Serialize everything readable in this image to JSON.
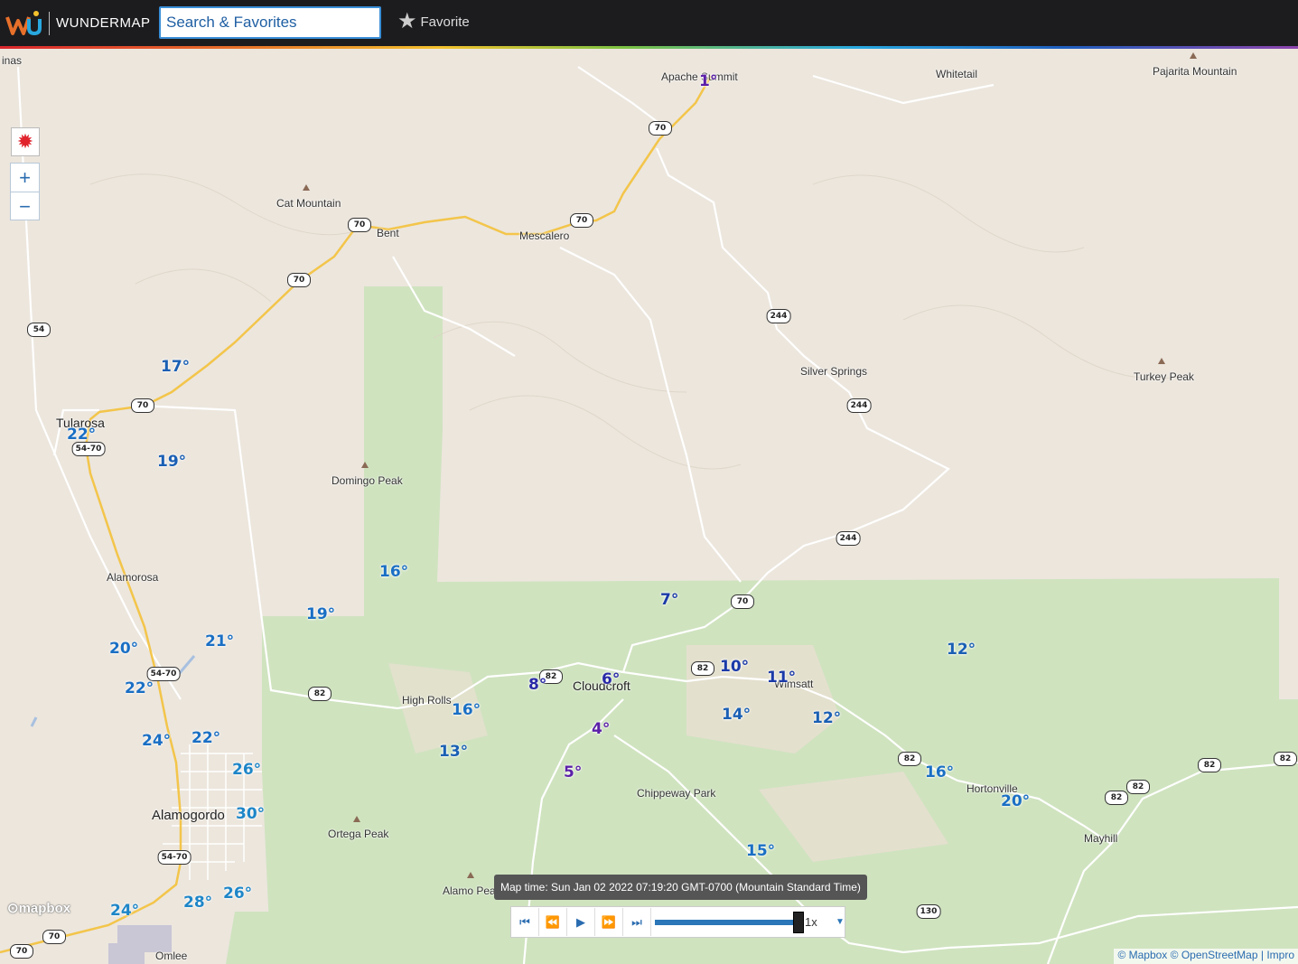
{
  "header": {
    "brand": "WUNDERMAP",
    "search_placeholder": "Search & Favorites",
    "favorite_label": "Favorite"
  },
  "controls": {
    "zoom_in": "+",
    "zoom_out": "−"
  },
  "player": {
    "map_time": "Map time: Sun Jan 02 2022 07:19:20 GMT-0700 (Mountain Standard Time)",
    "speed": "1x",
    "progress": 1.0
  },
  "attribution": {
    "logo": "mapbox",
    "text": "© Mapbox © OpenStreetMap | Impro"
  },
  "places": [
    {
      "name": "inas"
    },
    {
      "name": "Apache Summit"
    },
    {
      "name": "Whitetail"
    },
    {
      "name": "Pajarita Mountain"
    },
    {
      "name": "Cat Mountain"
    },
    {
      "name": "Bent"
    },
    {
      "name": "Mescalero"
    },
    {
      "name": "Silver Springs"
    },
    {
      "name": "Turkey Peak"
    },
    {
      "name": "Tularosa"
    },
    {
      "name": "Domingo Peak"
    },
    {
      "name": "Alamorosa"
    },
    {
      "name": "High Rolls"
    },
    {
      "name": "Cloudcroft"
    },
    {
      "name": "Wimsatt"
    },
    {
      "name": "Hortonville"
    },
    {
      "name": "Chippeway Park"
    },
    {
      "name": "Mayhill"
    },
    {
      "name": "Alamogordo"
    },
    {
      "name": "Ortega Peak"
    },
    {
      "name": "Alamo Peak"
    },
    {
      "name": "Omlee"
    }
  ],
  "temperatures": [
    {
      "value": "1°",
      "color": "#5b1fa8"
    },
    {
      "value": "17°",
      "color": "#1a5fb4"
    },
    {
      "value": "22°",
      "color": "#1a6fc4"
    },
    {
      "value": "19°",
      "color": "#1a5fb4"
    },
    {
      "value": "16°",
      "color": "#1a6fc4"
    },
    {
      "value": "19°",
      "color": "#1a6fc4"
    },
    {
      "value": "21°",
      "color": "#1a6fc4"
    },
    {
      "value": "20°",
      "color": "#1a6fc4"
    },
    {
      "value": "22°",
      "color": "#1a6fc4"
    },
    {
      "value": "24°",
      "color": "#1a6fc4"
    },
    {
      "value": "22°",
      "color": "#1a6fc4"
    },
    {
      "value": "26°",
      "color": "#1e86c8"
    },
    {
      "value": "30°",
      "color": "#1e86c8"
    },
    {
      "value": "26°",
      "color": "#1e86c8"
    },
    {
      "value": "28°",
      "color": "#1e86c8"
    },
    {
      "value": "24°",
      "color": "#1e86c8"
    },
    {
      "value": "7°",
      "color": "#1b3aa8"
    },
    {
      "value": "8°",
      "color": "#2a2aa8"
    },
    {
      "value": "6°",
      "color": "#2a2aa8"
    },
    {
      "value": "16°",
      "color": "#1a6fc4"
    },
    {
      "value": "13°",
      "color": "#1a5fb4"
    },
    {
      "value": "4°",
      "color": "#5b1fa8"
    },
    {
      "value": "5°",
      "color": "#5b1fa8"
    },
    {
      "value": "10°",
      "color": "#1b3aa8"
    },
    {
      "value": "11°",
      "color": "#1b3aa8"
    },
    {
      "value": "14°",
      "color": "#1a5fb4"
    },
    {
      "value": "12°",
      "color": "#1a5fb4"
    },
    {
      "value": "12°",
      "color": "#1a5fb4"
    },
    {
      "value": "16°",
      "color": "#1a6fc4"
    },
    {
      "value": "20°",
      "color": "#1a6fc4"
    },
    {
      "value": "15°",
      "color": "#1a6fc4"
    }
  ],
  "shields": [
    "70",
    "70",
    "70",
    "70",
    "70",
    "244",
    "244",
    "244",
    "54",
    "70",
    "54-70",
    "54-70",
    "82",
    "82",
    "82",
    "82",
    "82",
    "82",
    "82",
    "82",
    "54-70",
    "70",
    "70",
    "130"
  ],
  "colors": {
    "land": "#ece6dd",
    "forest": "#cfe3bf",
    "highway": "#f3c54a",
    "road": "#ffffff",
    "topbar": "#1c1c1f"
  }
}
